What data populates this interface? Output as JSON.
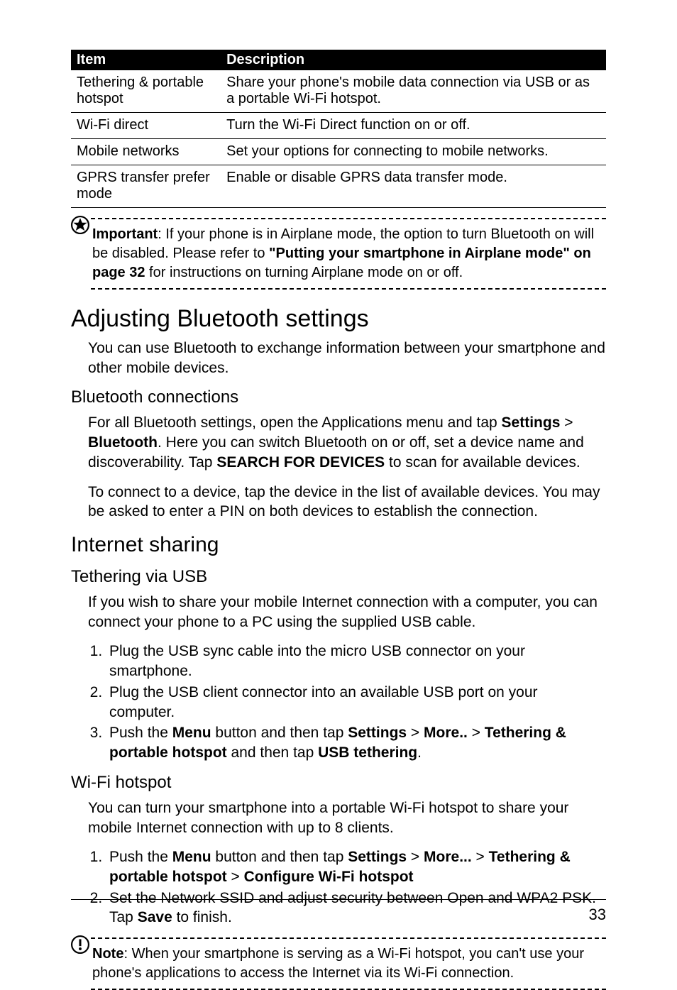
{
  "table": {
    "head": {
      "c1": "Item",
      "c2": "Description"
    },
    "rows": [
      {
        "c1": "Tethering & portable hotspot",
        "c2": "Share your phone's mobile data connection via USB or as a portable Wi-Fi hotspot."
      },
      {
        "c1": "Wi-Fi direct",
        "c2": "Turn the Wi-Fi Direct function on or off."
      },
      {
        "c1": "Mobile networks",
        "c2": "Set your options for connecting to mobile networks."
      },
      {
        "c1": "GPRS transfer prefer mode",
        "c2": "Enable or disable GPRS data transfer mode."
      }
    ]
  },
  "important": {
    "label": "Important",
    "before_link": ": If your phone is in Airplane mode, the option to turn Bluetooth on will be disabled. Please refer to ",
    "link": "\"Putting your smartphone in Airplane mode\" on page 32",
    "after_link": " for instructions on turning Airplane mode on or off."
  },
  "bluetooth": {
    "title": "Adjusting Bluetooth settings",
    "intro": "You can use Bluetooth to exchange information between your smartphone and other mobile devices.",
    "sub1": "Bluetooth connections",
    "p1_a": "For all Bluetooth settings, open the Applications menu and tap ",
    "p1_b": "Settings",
    "p1_c": " > ",
    "p1_d": "Bluetooth",
    "p1_e": ". Here you can switch Bluetooth on or off, set a device name and discoverability. Tap ",
    "p1_f": "SEARCH FOR DEVICES",
    "p1_g": " to scan for available devices.",
    "p2": "To connect to a device, tap the device in the list of available devices. You may be asked to enter a PIN on both devices to establish the connection."
  },
  "internet": {
    "title": "Internet sharing",
    "sub1": "Tethering via USB",
    "p1": "If you wish to share your mobile Internet connection with a computer, you can connect your phone to a PC using the supplied USB cable.",
    "steps1": {
      "s1": "Plug the USB sync cable into the micro USB connector on your smartphone.",
      "s2": "Plug the USB client connector into an available USB port on your computer.",
      "s3_a": "Push the ",
      "s3_b": "Menu",
      "s3_c": " button and then tap ",
      "s3_d": "Settings",
      "s3_e": " > ",
      "s3_f": "More..",
      "s3_g": " > ",
      "s3_h": "Tethering & portable hotspot",
      "s3_i": " and then tap ",
      "s3_j": "USB tethering",
      "s3_k": "."
    },
    "sub2": "Wi-Fi hotspot",
    "p2": "You can turn your smartphone into a portable Wi-Fi hotspot to share your mobile Internet connection with up to 8 clients.",
    "steps2": {
      "s1_a": "Push the ",
      "s1_b": "Menu",
      "s1_c": " button and then tap ",
      "s1_d": "Settings",
      "s1_e": " > ",
      "s1_f": "More...",
      "s1_g": " > ",
      "s1_h": "Tethering & portable hotspot",
      "s1_i": " > ",
      "s1_j": "Configure Wi-Fi hotspot",
      "s2_a": "Set the Network SSID and adjust security between Open and WPA2 PSK. Tap ",
      "s2_b": "Save",
      "s2_c": " to finish."
    }
  },
  "note": {
    "label": "Note",
    "text": ": When your smartphone is serving as a Wi-Fi hotspot, you can't use your phone's applications to access the Internet via its Wi-Fi connection."
  },
  "pagenum": "33"
}
